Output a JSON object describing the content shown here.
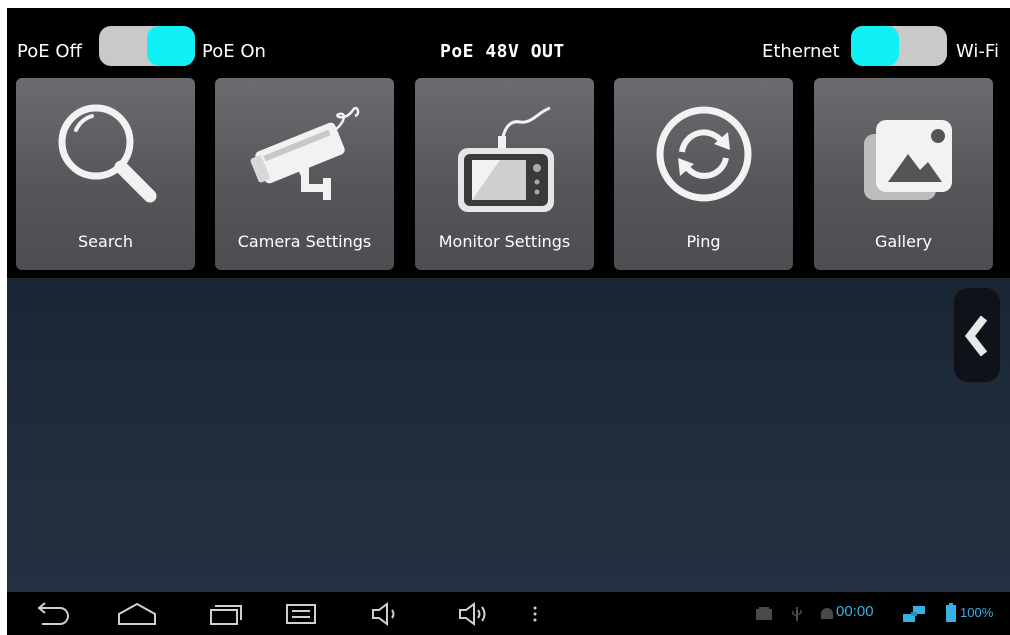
{
  "toggles": {
    "poe": {
      "off_label": "PoE Off",
      "on_label": "PoE On",
      "state": "on"
    },
    "network": {
      "left_label": "Ethernet",
      "right_label": "Wi-Fi",
      "state": "ethernet"
    }
  },
  "poe_status": "PoE 48V OUT",
  "accent_color": "#12f0f7",
  "tiles": [
    {
      "label": "Search",
      "icon": "magnifier-icon"
    },
    {
      "label": "Camera Settings",
      "icon": "cctv-camera-icon"
    },
    {
      "label": "Monitor Settings",
      "icon": "tester-monitor-icon"
    },
    {
      "label": "Ping",
      "icon": "refresh-circle-icon"
    },
    {
      "label": "Gallery",
      "icon": "gallery-icon"
    }
  ],
  "navbar": {
    "buttons": [
      "back-icon",
      "home-icon",
      "recents-icon",
      "screenshot-icon",
      "volume-down-icon",
      "volume-up-icon",
      "menu-dots-icon"
    ]
  },
  "status": {
    "time": "00:00",
    "battery": "100%",
    "icons": [
      "notification-icon",
      "usb-icon",
      "android-icon",
      "ethernet-icon",
      "battery-icon"
    ],
    "color": "#36b1e4"
  }
}
